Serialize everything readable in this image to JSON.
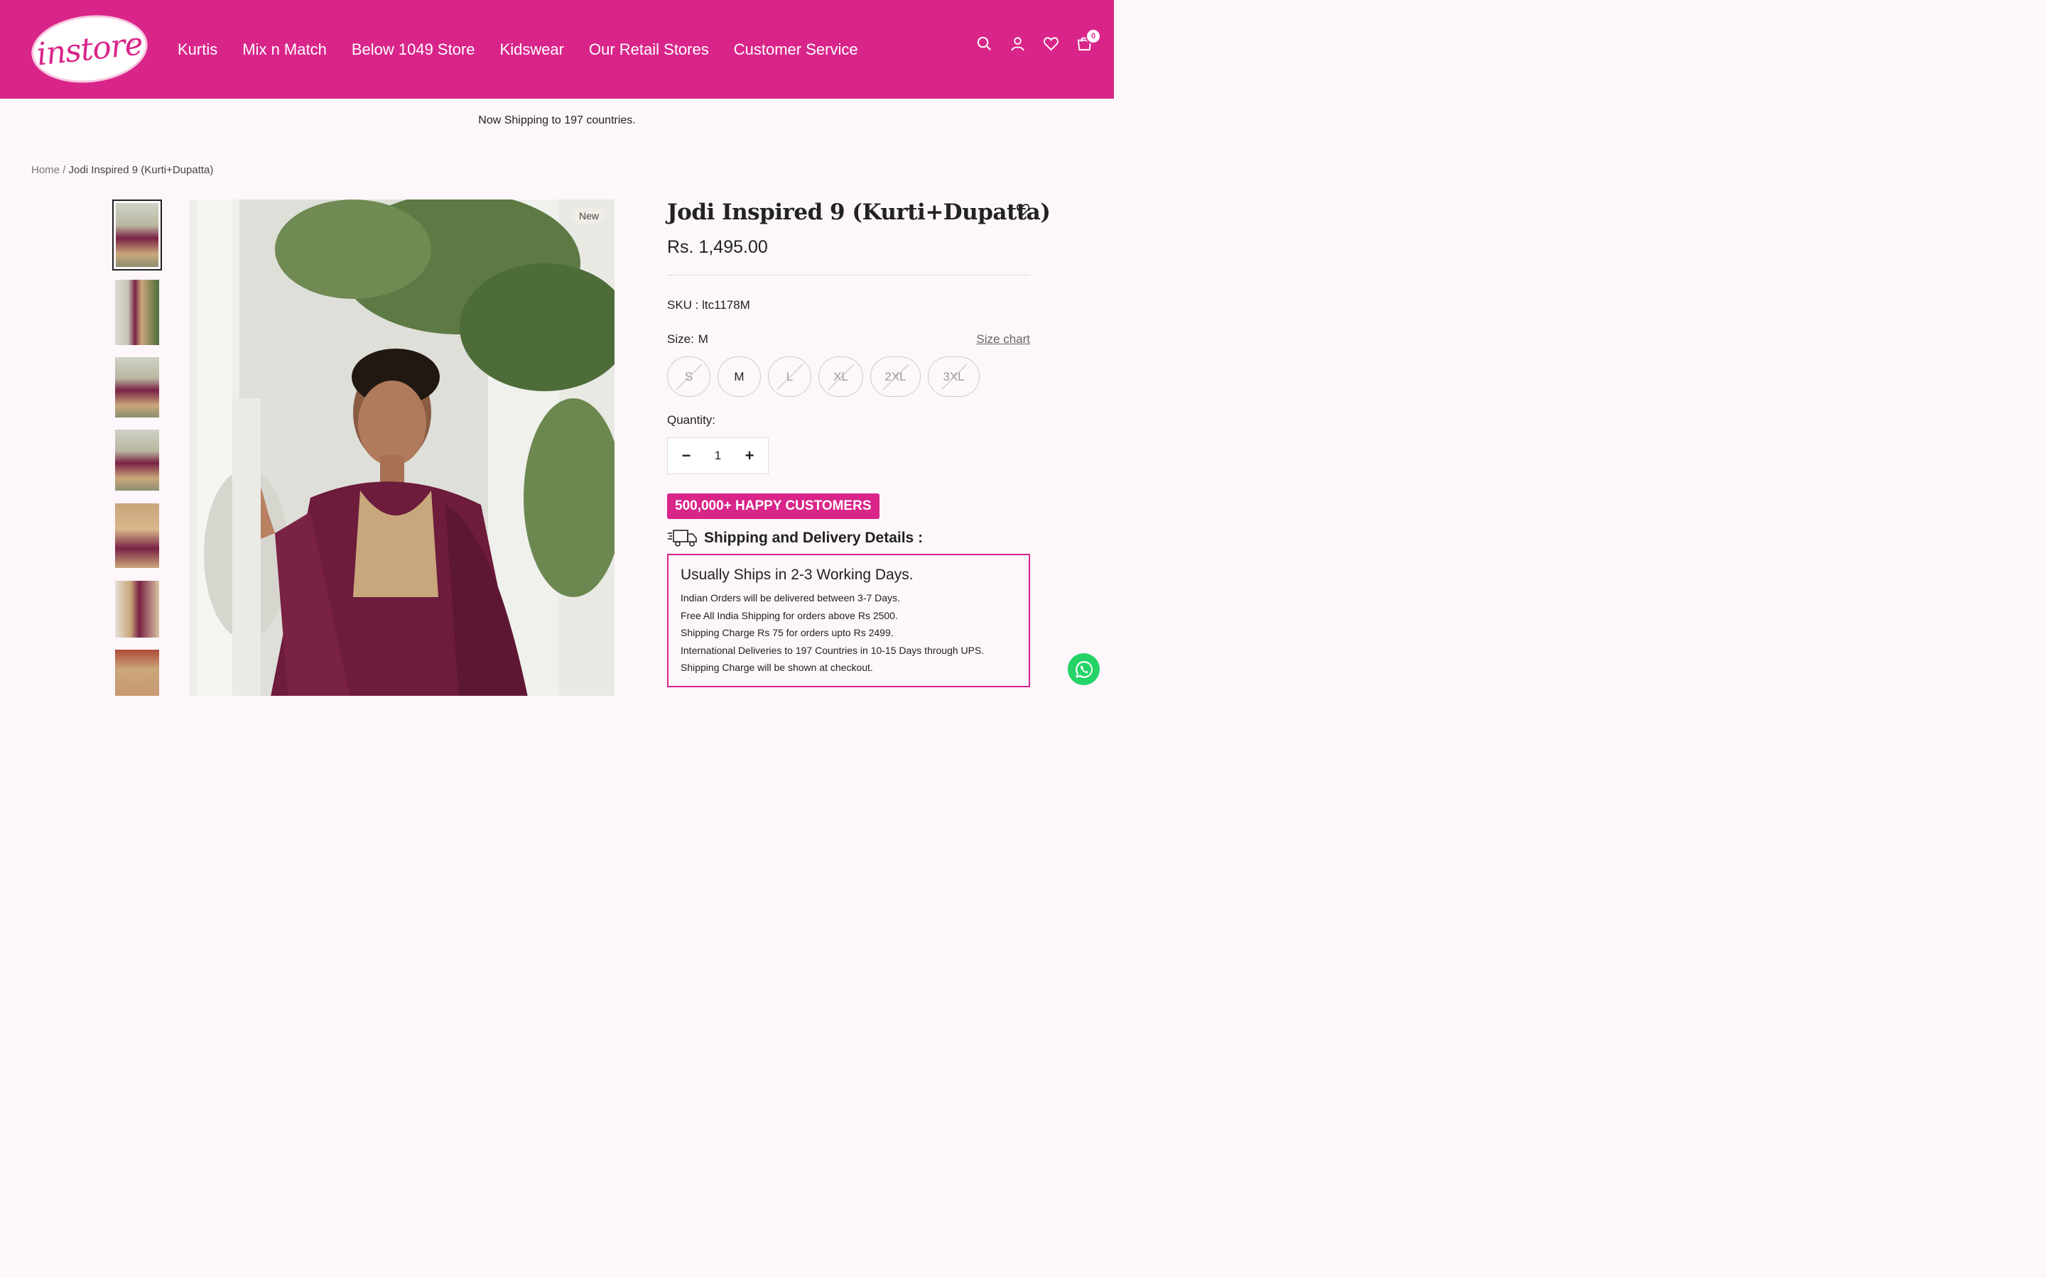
{
  "header": {
    "logo_text": "instore",
    "logo_reg": "®",
    "nav": [
      "Kurtis",
      "Mix n Match",
      "Below 1049 Store",
      "Kidswear",
      "Our Retail Stores",
      "Customer Service"
    ],
    "cart_count": "0",
    "brand_color": "#d9258a"
  },
  "announcement": "Now Shipping to 197 countries.",
  "breadcrumb": {
    "home": "Home",
    "separator": "/",
    "current": "Jodi Inspired 9 (Kurti+Dupatta)"
  },
  "gallery": {
    "badge": "New",
    "thumbnail_count": 7
  },
  "product": {
    "title": "Jodi Inspired 9 (Kurti+Dupatta)",
    "price": "Rs. 1,495.00",
    "sku": "SKU : ltc1178M",
    "size_label": "Size:",
    "size_selected": "M",
    "size_chart": "Size chart",
    "sizes": [
      "S",
      "M",
      "L",
      "XL",
      "2XL",
      "3XL"
    ],
    "quantity_label": "Quantity:",
    "quantity": "1",
    "qty_minus": "−",
    "qty_plus": "+"
  },
  "promo": "500,000+ HAPPY CUSTOMERS",
  "shipping": {
    "heading": "Shipping and Delivery Details :",
    "box_title": "Usually Ships in 2-3 Working Days.",
    "lines": [
      "Indian Orders will be delivered between 3-7 Days.",
      "Free All India Shipping for orders above Rs 2500.",
      "Shipping Charge Rs 75 for orders upto Rs 2499.",
      "International Deliveries to 197 Countries in 10-15 Days through UPS.",
      "Shipping Charge will be shown at checkout."
    ]
  }
}
